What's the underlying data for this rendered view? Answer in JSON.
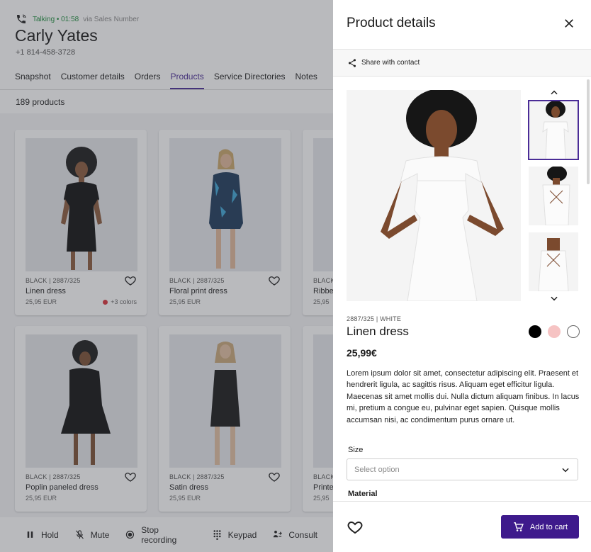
{
  "call": {
    "status": "Talking • 01:58",
    "via": "via Sales Number",
    "contact_name": "Carly Yates",
    "contact_phone": "+1 814-458-3728"
  },
  "tabs": [
    "Snapshot",
    "Customer details",
    "Orders",
    "Products",
    "Service Directories",
    "Notes"
  ],
  "active_tab": "Products",
  "product_count": "189 products",
  "products": [
    {
      "meta": "BLACK | 2887/325",
      "name": "Linen dress",
      "price": "25,95 EUR",
      "colors": "+3 colors"
    },
    {
      "meta": "BLACK | 2887/325",
      "name": "Floral print dress",
      "price": "25,95 EUR",
      "colors": ""
    },
    {
      "meta": "BLACK",
      "name": "Ribbe",
      "price": "25,95",
      "colors": ""
    },
    {
      "meta": "BLACK | 2887/325",
      "name": "Poplin paneled dress",
      "price": "25,95 EUR",
      "colors": ""
    },
    {
      "meta": "BLACK | 2887/325",
      "name": "Satin dress",
      "price": "25,95 EUR",
      "colors": ""
    },
    {
      "meta": "BLACK",
      "name": "Printe",
      "price": "25,95",
      "colors": ""
    }
  ],
  "call_controls": {
    "hold": "Hold",
    "mute": "Mute",
    "stop_recording": "Stop recording",
    "keypad": "Keypad",
    "consult": "Consult"
  },
  "panel": {
    "title": "Product details",
    "share_label": "Share with contact",
    "sku": "2887/325 | WHITE",
    "name": "Linen dress",
    "price": "25,99€",
    "description": "Lorem ipsum dolor sit amet, consectetur adipiscing elit. Praesent et hendrerit ligula, ac sagittis risus. Aliquam eget efficitur ligula. Maecenas sit amet mollis dui. Nulla dictum aliquam finibus. In lacus mi, pretium a congue eu, pulvinar eget sapien. Quisque mollis accumsan nisi, ac condimentum purus ornare ut.",
    "size_label": "Size",
    "size_placeholder": "Select option",
    "material_label": "Material",
    "add_to_cart": "Add to cart",
    "swatches": [
      "#000000",
      "#f6c3c3",
      "#ffffff"
    ]
  },
  "colors": {
    "accent": "#4a2c96",
    "cart_button": "#3e1a8c",
    "talking": "#1e8e3e"
  }
}
